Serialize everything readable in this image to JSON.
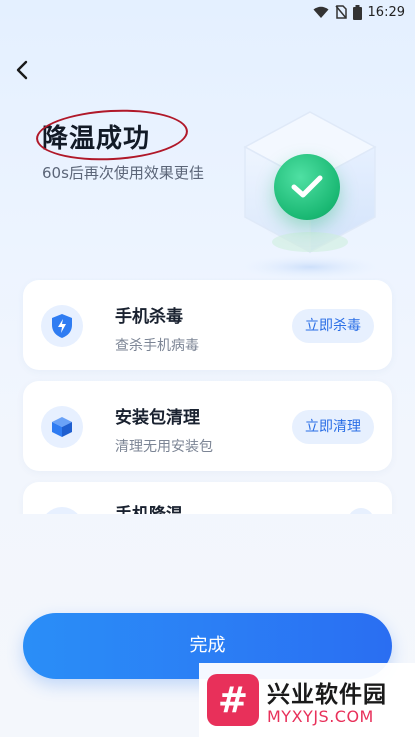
{
  "status_bar": {
    "time": "16:29",
    "icons": [
      "wifi-icon",
      "no-sim-icon",
      "battery-icon"
    ]
  },
  "header": {
    "back_icon": "chevron-left-icon",
    "title": "降温成功",
    "subtitle": "60s后再次使用效果更佳"
  },
  "hero": {
    "icon": "check-circle-icon",
    "accent_color": "#1ab873"
  },
  "cards": [
    {
      "icon": "shield-bolt-icon",
      "title": "手机杀毒",
      "desc": "查杀手机病毒",
      "button": "立即杀毒"
    },
    {
      "icon": "package-icon",
      "title": "安装包清理",
      "desc": "清理无用安装包",
      "button": "立即清理"
    },
    {
      "icon": "thermometer-icon",
      "title": "手机降温",
      "desc": "",
      "button": ""
    }
  ],
  "footer": {
    "done_label": "完成",
    "accent_color": "#2a7ff5"
  },
  "watermark": {
    "logo_glyph": "#",
    "title": "兴业软件园",
    "url": "MYXYJS.COM"
  }
}
